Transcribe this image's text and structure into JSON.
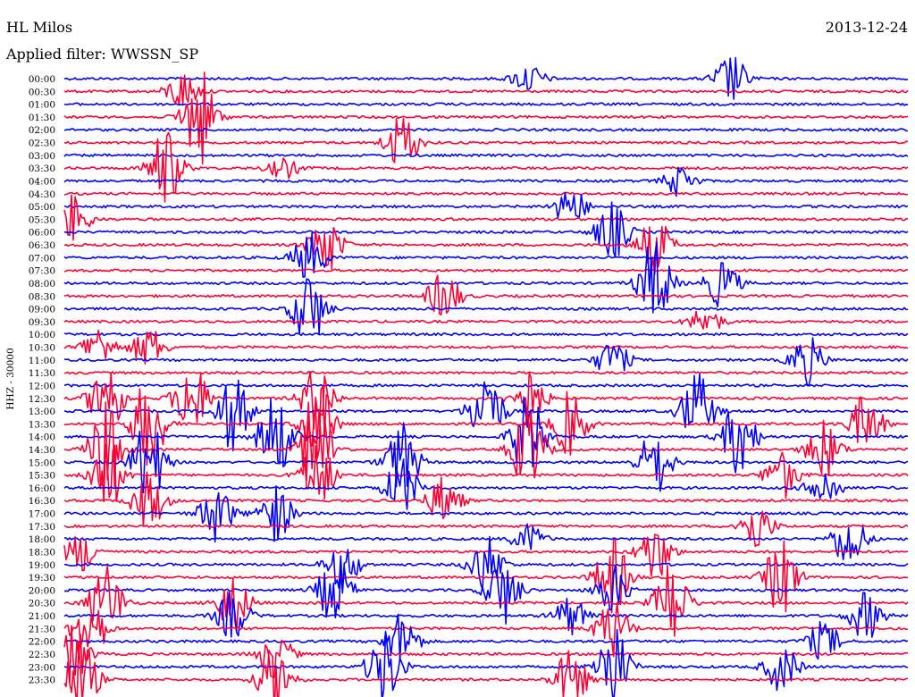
{
  "header": {
    "station": "HL Milos",
    "filter": "Applied filter: WWSSN_SP",
    "date": "2013-12-24"
  },
  "chart_data": {
    "type": "line",
    "title": "HL Milos",
    "subtitle": "Applied filter: WWSSN_SP",
    "ylabel": "HHZ - 30000",
    "xlabel": "",
    "x_range_minutes": [
      0,
      30
    ],
    "grid": false,
    "colors": {
      "series_a": "#0000ff",
      "series_b": "#ff0033",
      "background": "#ffffff",
      "text": "#000000"
    },
    "traces": [
      {
        "label": "00:00",
        "color": "#0000ff",
        "bursts": [
          [
            0.55,
            0.3
          ],
          [
            0.79,
            0.5
          ]
        ]
      },
      {
        "label": "00:30",
        "color": "#ff0033",
        "bursts": [
          [
            0.14,
            0.4
          ]
        ]
      },
      {
        "label": "01:00",
        "color": "#0000ff",
        "bursts": []
      },
      {
        "label": "01:30",
        "color": "#ff0033",
        "bursts": [
          [
            0.16,
            1.0
          ]
        ]
      },
      {
        "label": "02:00",
        "color": "#0000ff",
        "bursts": []
      },
      {
        "label": "02:30",
        "color": "#ff0033",
        "bursts": [
          [
            0.4,
            0.6
          ]
        ]
      },
      {
        "label": "03:00",
        "color": "#0000ff",
        "bursts": []
      },
      {
        "label": "03:30",
        "color": "#ff0033",
        "bursts": [
          [
            0.12,
            0.8
          ],
          [
            0.26,
            0.2
          ]
        ]
      },
      {
        "label": "04:00",
        "color": "#0000ff",
        "bursts": [
          [
            0.73,
            0.3
          ]
        ]
      },
      {
        "label": "04:30",
        "color": "#ff0033",
        "bursts": []
      },
      {
        "label": "05:00",
        "color": "#0000ff",
        "bursts": [
          [
            0.6,
            0.4
          ]
        ]
      },
      {
        "label": "05:30",
        "color": "#ff0033",
        "bursts": [
          [
            0.01,
            0.5
          ]
        ]
      },
      {
        "label": "06:00",
        "color": "#0000ff",
        "bursts": [
          [
            0.65,
            0.6
          ]
        ]
      },
      {
        "label": "06:30",
        "color": "#ff0033",
        "bursts": [
          [
            0.31,
            0.6
          ],
          [
            0.7,
            0.6
          ]
        ]
      },
      {
        "label": "07:00",
        "color": "#0000ff",
        "bursts": [
          [
            0.29,
            0.5
          ]
        ]
      },
      {
        "label": "07:30",
        "color": "#ff0033",
        "bursts": []
      },
      {
        "label": "08:00",
        "color": "#0000ff",
        "bursts": [
          [
            0.7,
            0.9
          ],
          [
            0.78,
            0.5
          ]
        ]
      },
      {
        "label": "08:30",
        "color": "#ff0033",
        "bursts": [
          [
            0.45,
            0.5
          ]
        ]
      },
      {
        "label": "09:00",
        "color": "#0000ff",
        "bursts": [
          [
            0.29,
            0.8
          ]
        ]
      },
      {
        "label": "09:30",
        "color": "#ff0033",
        "bursts": [
          [
            0.76,
            0.3
          ]
        ]
      },
      {
        "label": "10:00",
        "color": "#0000ff",
        "bursts": []
      },
      {
        "label": "10:30",
        "color": "#ff0033",
        "bursts": [
          [
            0.04,
            0.4
          ],
          [
            0.1,
            0.4
          ]
        ]
      },
      {
        "label": "11:00",
        "color": "#0000ff",
        "bursts": [
          [
            0.65,
            0.4
          ],
          [
            0.88,
            0.5
          ]
        ]
      },
      {
        "label": "11:30",
        "color": "#ff0033",
        "bursts": []
      },
      {
        "label": "12:00",
        "color": "#0000ff",
        "bursts": []
      },
      {
        "label": "12:30",
        "color": "#ff0033",
        "bursts": [
          [
            0.05,
            0.8
          ],
          [
            0.15,
            0.8
          ],
          [
            0.3,
            0.7
          ],
          [
            0.55,
            0.6
          ]
        ]
      },
      {
        "label": "13:00",
        "color": "#0000ff",
        "bursts": [
          [
            0.2,
            0.8
          ],
          [
            0.5,
            0.9
          ],
          [
            0.75,
            0.8
          ]
        ]
      },
      {
        "label": "13:30",
        "color": "#ff0033",
        "bursts": [
          [
            0.1,
            1.0
          ],
          [
            0.3,
            0.9
          ],
          [
            0.6,
            0.7
          ],
          [
            0.95,
            0.6
          ]
        ]
      },
      {
        "label": "14:00",
        "color": "#0000ff",
        "bursts": [
          [
            0.25,
            0.9
          ],
          [
            0.55,
            0.9
          ],
          [
            0.8,
            0.8
          ]
        ]
      },
      {
        "label": "14:30",
        "color": "#ff0033",
        "bursts": [
          [
            0.05,
            1.0
          ],
          [
            0.3,
            1.0
          ],
          [
            0.55,
            0.9
          ],
          [
            0.9,
            0.6
          ]
        ]
      },
      {
        "label": "15:00",
        "color": "#0000ff",
        "bursts": [
          [
            0.1,
            0.9
          ],
          [
            0.4,
            0.8
          ],
          [
            0.7,
            0.7
          ]
        ]
      },
      {
        "label": "15:30",
        "color": "#ff0033",
        "bursts": [
          [
            0.05,
            0.8
          ],
          [
            0.3,
            0.7
          ],
          [
            0.85,
            0.5
          ]
        ]
      },
      {
        "label": "16:00",
        "color": "#0000ff",
        "bursts": [
          [
            0.4,
            0.6
          ],
          [
            0.9,
            0.4
          ]
        ]
      },
      {
        "label": "16:30",
        "color": "#ff0033",
        "bursts": [
          [
            0.1,
            0.6
          ],
          [
            0.45,
            0.5
          ]
        ]
      },
      {
        "label": "17:00",
        "color": "#0000ff",
        "bursts": [
          [
            0.18,
            0.6
          ],
          [
            0.25,
            0.6
          ]
        ]
      },
      {
        "label": "17:30",
        "color": "#ff0033",
        "bursts": [
          [
            0.82,
            0.5
          ]
        ]
      },
      {
        "label": "18:00",
        "color": "#0000ff",
        "bursts": [
          [
            0.55,
            0.3
          ],
          [
            0.93,
            0.6
          ]
        ]
      },
      {
        "label": "18:30",
        "color": "#ff0033",
        "bursts": [
          [
            0.02,
            0.4
          ],
          [
            0.7,
            0.6
          ]
        ]
      },
      {
        "label": "19:00",
        "color": "#0000ff",
        "bursts": [
          [
            0.33,
            0.5
          ],
          [
            0.5,
            0.6
          ]
        ]
      },
      {
        "label": "19:30",
        "color": "#ff0033",
        "bursts": [
          [
            0.65,
            0.8
          ],
          [
            0.85,
            0.8
          ]
        ]
      },
      {
        "label": "20:00",
        "color": "#0000ff",
        "bursts": [
          [
            0.32,
            0.7
          ],
          [
            0.52,
            0.7
          ],
          [
            0.65,
            0.5
          ]
        ]
      },
      {
        "label": "20:30",
        "color": "#ff0033",
        "bursts": [
          [
            0.05,
            0.8
          ],
          [
            0.2,
            0.6
          ],
          [
            0.72,
            0.9
          ]
        ]
      },
      {
        "label": "21:00",
        "color": "#0000ff",
        "bursts": [
          [
            0.2,
            0.5
          ],
          [
            0.6,
            0.4
          ],
          [
            0.95,
            0.5
          ]
        ]
      },
      {
        "label": "21:30",
        "color": "#ff0033",
        "bursts": [
          [
            0.03,
            0.7
          ],
          [
            0.65,
            0.6
          ]
        ]
      },
      {
        "label": "22:00",
        "color": "#0000ff",
        "bursts": [
          [
            0.4,
            0.6
          ],
          [
            0.9,
            0.4
          ]
        ]
      },
      {
        "label": "22:30",
        "color": "#ff0033",
        "bursts": [
          [
            0.01,
            0.6
          ],
          [
            0.25,
            0.5
          ]
        ]
      },
      {
        "label": "23:00",
        "color": "#0000ff",
        "bursts": [
          [
            0.38,
            0.8
          ],
          [
            0.65,
            0.9
          ],
          [
            0.85,
            0.5
          ]
        ]
      },
      {
        "label": "23:30",
        "color": "#ff0033",
        "bursts": [
          [
            0.02,
            0.8
          ],
          [
            0.25,
            0.7
          ],
          [
            0.6,
            0.6
          ]
        ]
      }
    ]
  }
}
